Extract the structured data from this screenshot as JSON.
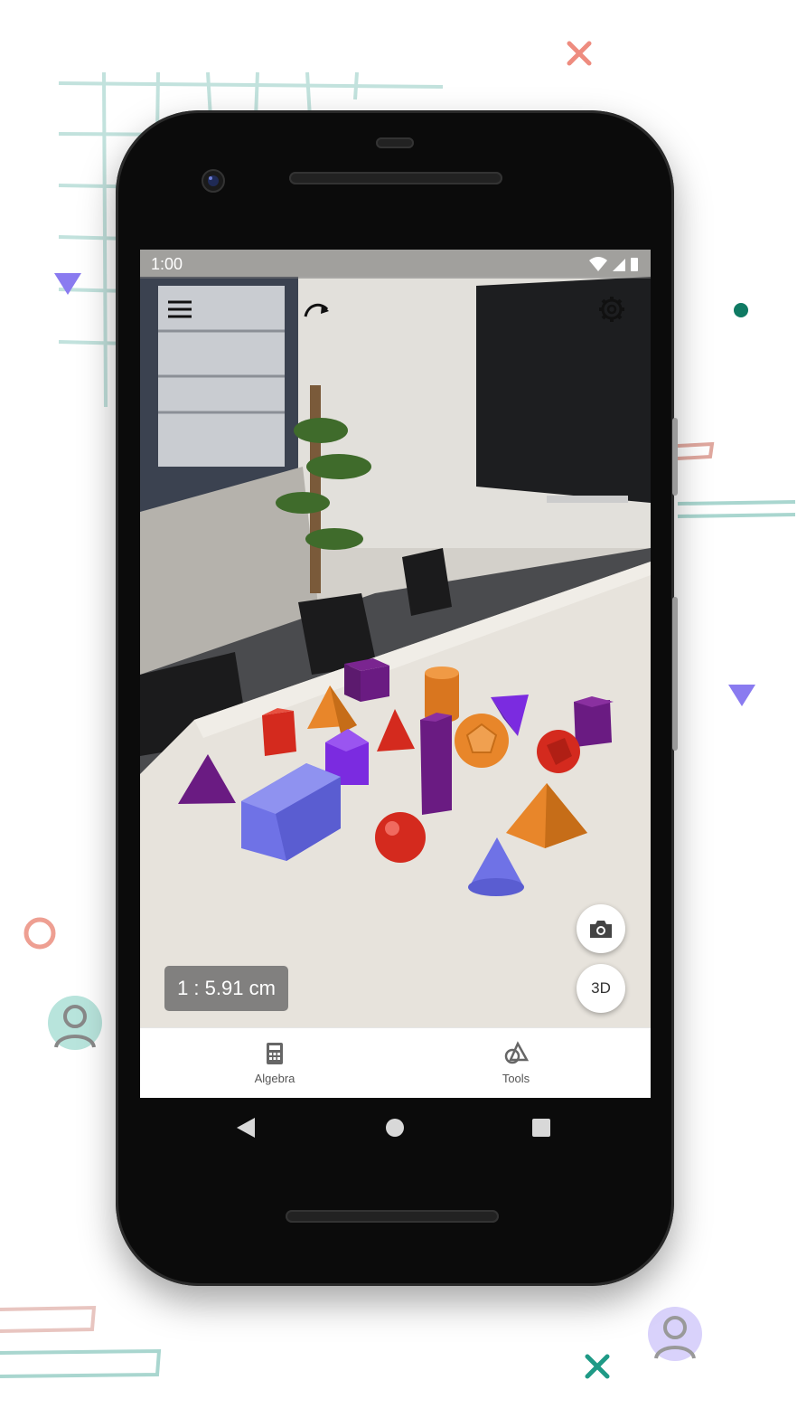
{
  "status_bar": {
    "time": "1:00"
  },
  "toolbar": {
    "menu_icon": "hamburger-menu-icon",
    "redo_icon": "redo-arrow-icon",
    "settings_icon": "gear-icon"
  },
  "scale": {
    "label": "1 : 5.91 cm"
  },
  "fabs": {
    "camera_icon": "camera-icon",
    "view_3d_label": "3D"
  },
  "bottom_nav": {
    "items": [
      {
        "label": "Algebra",
        "icon": "calculator-icon"
      },
      {
        "label": "Tools",
        "icon": "geometry-tools-icon"
      }
    ]
  },
  "system_nav": {
    "back_icon": "back-triangle-icon",
    "home_icon": "home-circle-icon",
    "recents_icon": "recents-square-icon"
  },
  "colors": {
    "purple": "#6a1b82",
    "orange": "#e8862a",
    "red": "#d42a1e",
    "blue": "#6f72e6",
    "violet": "#7b2be0",
    "teal": "#0f7a63",
    "accent_triangle": "#8a7bf0"
  }
}
